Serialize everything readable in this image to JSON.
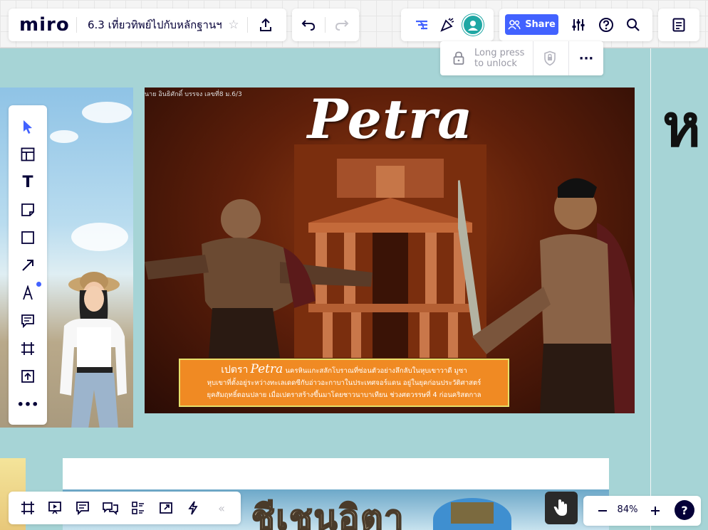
{
  "app": {
    "logo": "miro"
  },
  "board": {
    "title": "6.3 เที่ยวทิพย์ไปกับหลักฐานฯ"
  },
  "header": {
    "share_label": "Share",
    "zoom_level": "84%"
  },
  "lock_popup": {
    "line1": "Long press",
    "line2": "to unlock"
  },
  "canvas": {
    "petra_author": "นาย อินธิศักดิ์ บรรจง เลขที่8 ม.6/3",
    "petra_title": "Petra",
    "petra_caption_lead": "เปตรา",
    "petra_caption_word": "Petra",
    "petra_caption_rest": "นครหินแกะสลักโบราณที่ซ่อนตัวอย่างลึกลับในหุบเขาวาดี มูซา",
    "petra_caption_line2": "หุบเขาที่ตั้งอยู่ระหว่างทะเลเดดซีกับอ่าวอะกาบาในประเทศจอร์แดน อยู่ในยุคก่อนประวัติศาสตร์",
    "petra_caption_line3": "ยุคสัมฤทธิ์ตอนปลาย เมื่อเปตราสร้างขึ้นมาโดยชาวนาบาเทียน ช่วงศตวรรษที่ 4 ก่อนคริสตกาล",
    "right_char": "ห",
    "bottom_title": "ชีเชนอิตา"
  },
  "icons": {
    "star": "star-icon",
    "upload": "upload-icon",
    "undo": "undo-icon",
    "redo": "redo-icon",
    "reactions": "reactions-icon",
    "celebrate": "celebrate-icon",
    "settings": "sliders-icon",
    "help": "help-icon",
    "search": "search-icon",
    "notes": "notes-icon"
  },
  "colors": {
    "accent": "#4262ff",
    "canvas": "#a6d4d6",
    "caption": "#f08a23"
  }
}
